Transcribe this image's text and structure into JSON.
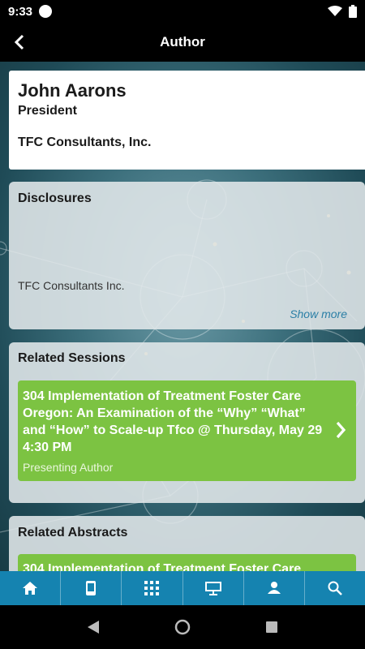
{
  "status_bar": {
    "time": "9:33"
  },
  "header": {
    "title": "Author"
  },
  "author": {
    "name": "John Aarons",
    "role": "President",
    "organization": "TFC Consultants, Inc."
  },
  "disclosures": {
    "heading": "Disclosures",
    "text": "TFC Consultants Inc.",
    "show_more": "Show more"
  },
  "related_sessions": {
    "heading": "Related Sessions",
    "items": [
      {
        "title": "304 Implementation of Treatment Foster Care Oregon: An Examination of the “Why” “What” and “How” to Scale-up Tfco @ Thursday, May 29 4:30 PM",
        "role": "Presenting Author"
      }
    ]
  },
  "related_abstracts": {
    "heading": "Related Abstracts",
    "items": [
      {
        "title": "304 Implementation of Treatment Foster Care"
      }
    ]
  },
  "bottom_nav": {
    "items": [
      "home-icon",
      "phone-icon",
      "grid-icon",
      "presentation-icon",
      "network-icon",
      "search-icon"
    ]
  },
  "colors": {
    "accent_green": "#7cc342",
    "nav_blue": "#1583b0",
    "link_blue": "#2b7fa6"
  }
}
